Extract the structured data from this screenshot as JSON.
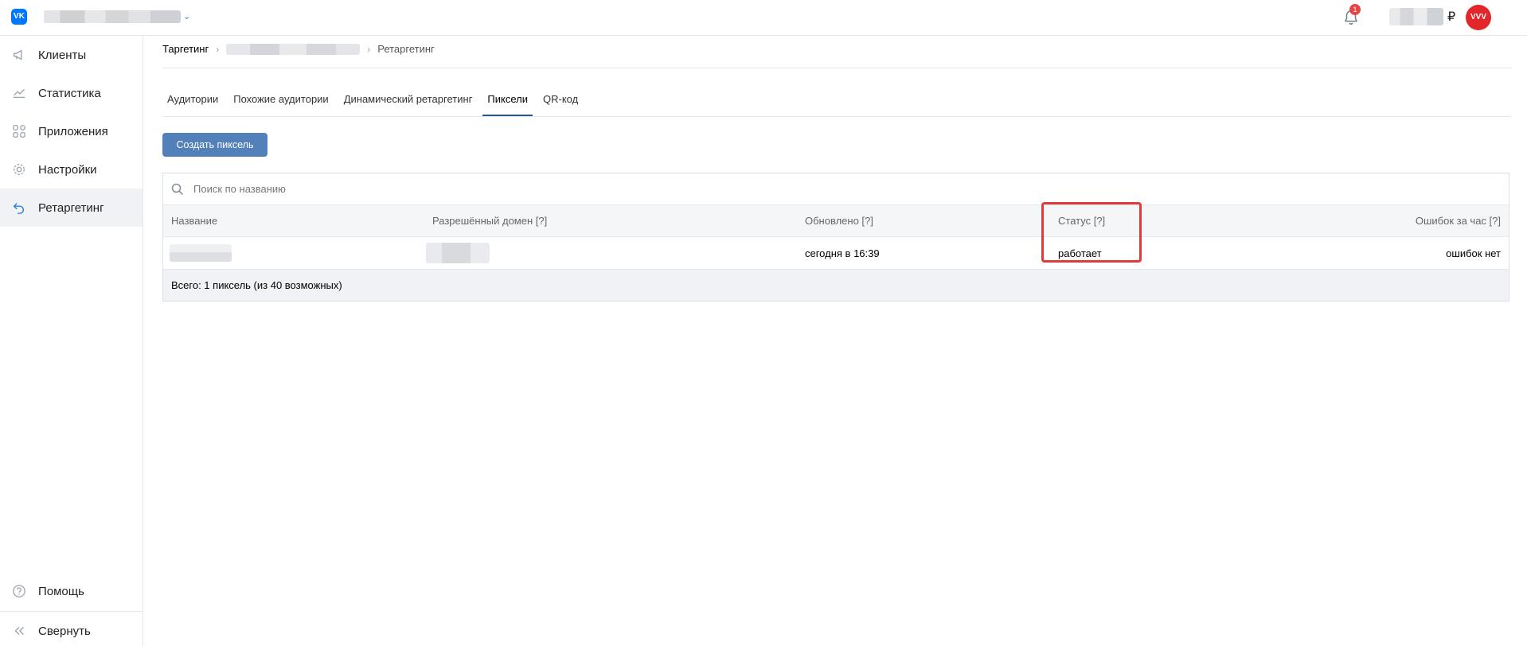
{
  "header": {
    "logo_text": "VK",
    "notifications_count": "1",
    "currency_symbol": "₽",
    "avatar_text": "VVV"
  },
  "sidebar": {
    "items": [
      {
        "label": "Клиенты",
        "icon": "megaphone-icon"
      },
      {
        "label": "Статистика",
        "icon": "chart-line-icon"
      },
      {
        "label": "Приложения",
        "icon": "apps-grid-icon"
      },
      {
        "label": "Настройки",
        "icon": "gear-icon"
      },
      {
        "label": "Ретаргетинг",
        "icon": "retarget-icon",
        "active": true
      }
    ],
    "help_label": "Помощь",
    "collapse_label": "Свернуть"
  },
  "breadcrumb": {
    "first": "Таргетинг",
    "last": "Ретаргетинг"
  },
  "tabs": [
    {
      "label": "Аудитории"
    },
    {
      "label": "Похожие аудитории"
    },
    {
      "label": "Динамический ретаргетинг"
    },
    {
      "label": "Пиксели",
      "active": true
    },
    {
      "label": "QR-код"
    }
  ],
  "create_button_label": "Создать пиксель",
  "search": {
    "placeholder": "Поиск по названию"
  },
  "table": {
    "columns": [
      "Название",
      "Разрешённый домен [?]",
      "Обновлено [?]",
      "Статус [?]",
      "Ошибок за час [?]"
    ],
    "row": {
      "updated": "сегодня в 16:39",
      "status": "работает",
      "errors": "ошибок нет"
    },
    "footer": "Всего: 1 пиксель (из 40 возможных)"
  },
  "colors": {
    "accent": "#5181b8",
    "active_tab_underline": "#2a5885",
    "status_ok": "#3c5e1f",
    "highlight": "#e03a3a",
    "vk_blue": "#0077ff"
  }
}
